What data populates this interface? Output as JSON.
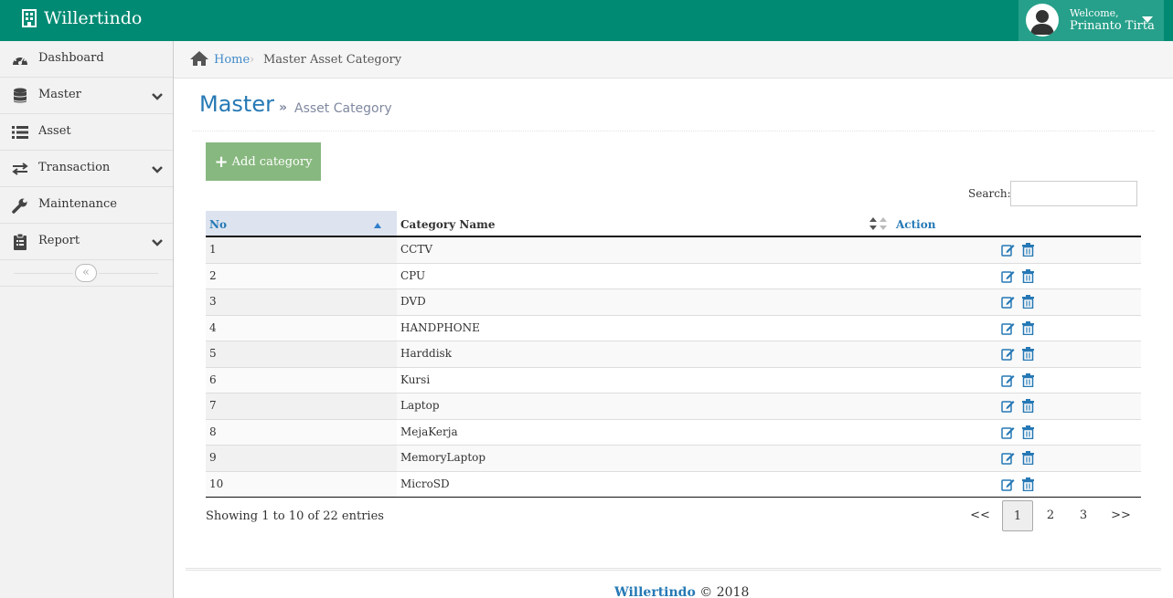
{
  "app": {
    "brand": "Willertindo"
  },
  "user": {
    "welcome": "Welcome,",
    "name": "Prinanto Tirta"
  },
  "sidebar": {
    "items": [
      {
        "label": "Dashboard",
        "icon": "dashboard-icon"
      },
      {
        "label": "Master",
        "icon": "database-icon",
        "has_submenu": true
      },
      {
        "label": "Asset",
        "icon": "list-icon"
      },
      {
        "label": "Transaction",
        "icon": "exchange-icon",
        "has_submenu": true
      },
      {
        "label": "Maintenance",
        "icon": "wrench-icon"
      },
      {
        "label": "Report",
        "icon": "clipboard-icon",
        "has_submenu": true
      }
    ],
    "collapse_glyph": "«"
  },
  "breadcrumb": {
    "home": "Home",
    "sep": "›",
    "current": "Master Asset Category"
  },
  "page": {
    "title": "Master",
    "sub_glyph": "»",
    "subtitle": "Asset Category"
  },
  "toolbar": {
    "add_label": "Add category",
    "add_glyph": "+"
  },
  "search": {
    "label": "Search:",
    "value": ""
  },
  "table": {
    "headers": {
      "no": "No",
      "name": "Category Name",
      "action": "Action"
    },
    "rows": [
      {
        "no": "1",
        "name": "CCTV"
      },
      {
        "no": "2",
        "name": "CPU"
      },
      {
        "no": "3",
        "name": "DVD"
      },
      {
        "no": "4",
        "name": "HANDPHONE"
      },
      {
        "no": "5",
        "name": "Harddisk"
      },
      {
        "no": "6",
        "name": "Kursi"
      },
      {
        "no": "7",
        "name": "Laptop"
      },
      {
        "no": "8",
        "name": "MejaKerja"
      },
      {
        "no": "9",
        "name": "MemoryLaptop"
      },
      {
        "no": "10",
        "name": "MicroSD"
      }
    ]
  },
  "pagination": {
    "info": "Showing 1 to 10 of 22 entries",
    "first": "<<",
    "pages": [
      "1",
      "2",
      "3"
    ],
    "active": "1",
    "last": ">>"
  },
  "footer": {
    "brand": "Willertindo",
    "copy": "© 2018"
  },
  "colors": {
    "navbar": "#008a73",
    "user_box": "#26a08a",
    "link": "#2679b5",
    "add_button": "#87b87f"
  }
}
